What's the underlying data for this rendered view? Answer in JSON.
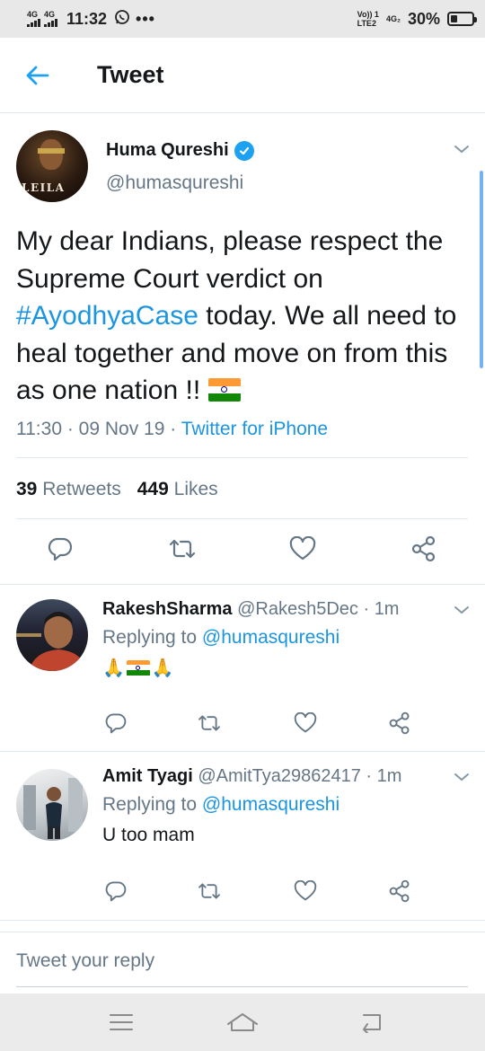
{
  "status_bar": {
    "network_1": "4G",
    "network_2": "4G",
    "time": "11:32",
    "volte": "Vo)) 1",
    "lte": "LTE2",
    "network_3": "4G₂",
    "battery": "30%",
    "battery_level": 0.3
  },
  "header": {
    "title": "Tweet"
  },
  "tweet": {
    "author_name": "Huma Qureshi",
    "author_handle": "@humasqureshi",
    "avatar_text": "LEILA",
    "text_before": "My dear Indians, please respect the Supreme Court verdict on ",
    "hashtag": "#AyodhyaCase",
    "text_after": " today. We all need to heal together and move on from this as one nation !! ",
    "time": "11:30",
    "date": "09 Nov 19",
    "source": "Twitter for iPhone",
    "retweets_count": "39",
    "retweets_label": "Retweets",
    "likes_count": "449",
    "likes_label": "Likes"
  },
  "replies": [
    {
      "name": "RakeshSharma",
      "handle": "@Rakesh5Dec",
      "time": "1m",
      "replying_label": "Replying to",
      "replying_to": "@humasqureshi",
      "body": ""
    },
    {
      "name": "Amit Tyagi",
      "handle": "@AmitTya29862417",
      "time": "1m",
      "replying_label": "Replying to",
      "replying_to": "@humasqureshi",
      "body": "U too mam"
    }
  ],
  "composer": {
    "placeholder": "Tweet your reply"
  },
  "icons": {
    "back": "arrow-left-icon",
    "verified": "verified-badge-icon",
    "more": "chevron-down-icon",
    "reply": "reply-icon",
    "retweet": "retweet-icon",
    "like": "heart-icon",
    "share": "share-icon",
    "menu": "menu-icon",
    "home": "home-icon",
    "back_nav": "back-nav-icon"
  },
  "colors": {
    "accent": "#1da1f2",
    "link": "#1b95e0",
    "muted": "#657786"
  }
}
